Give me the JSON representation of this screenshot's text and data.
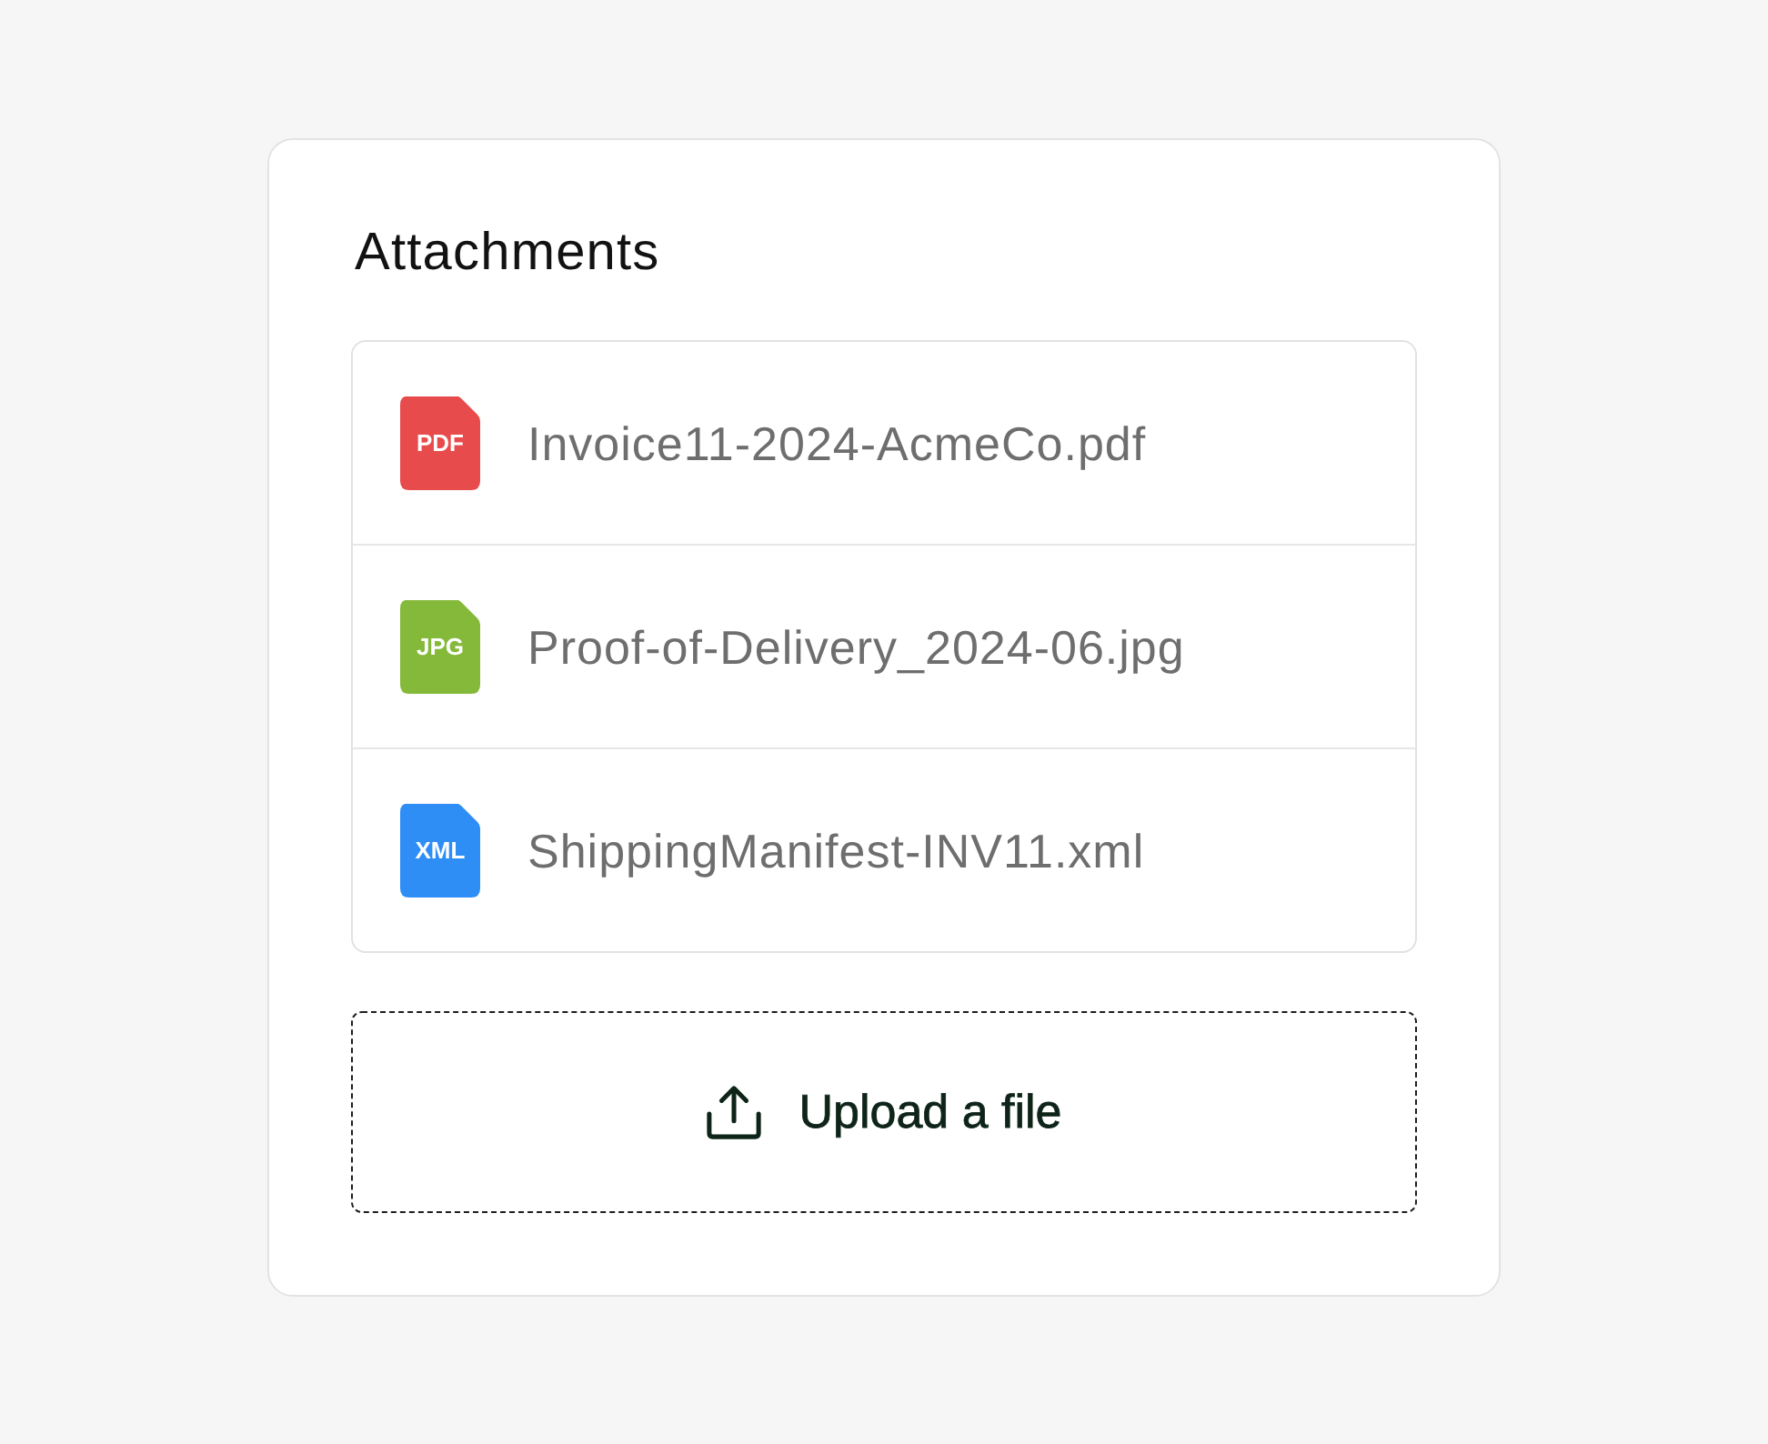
{
  "card": {
    "title": "Attachments"
  },
  "files": [
    {
      "type_label": "PDF",
      "name": "Invoice11-2024-AcmeCo.pdf",
      "color": "#e84b4b"
    },
    {
      "type_label": "JPG",
      "name": "Proof-of-Delivery_2024-06.jpg",
      "color": "#84b93a"
    },
    {
      "type_label": "XML",
      "name": "ShippingManifest-INV11.xml",
      "color": "#2f8df6"
    }
  ],
  "upload": {
    "label": "Upload a file"
  }
}
